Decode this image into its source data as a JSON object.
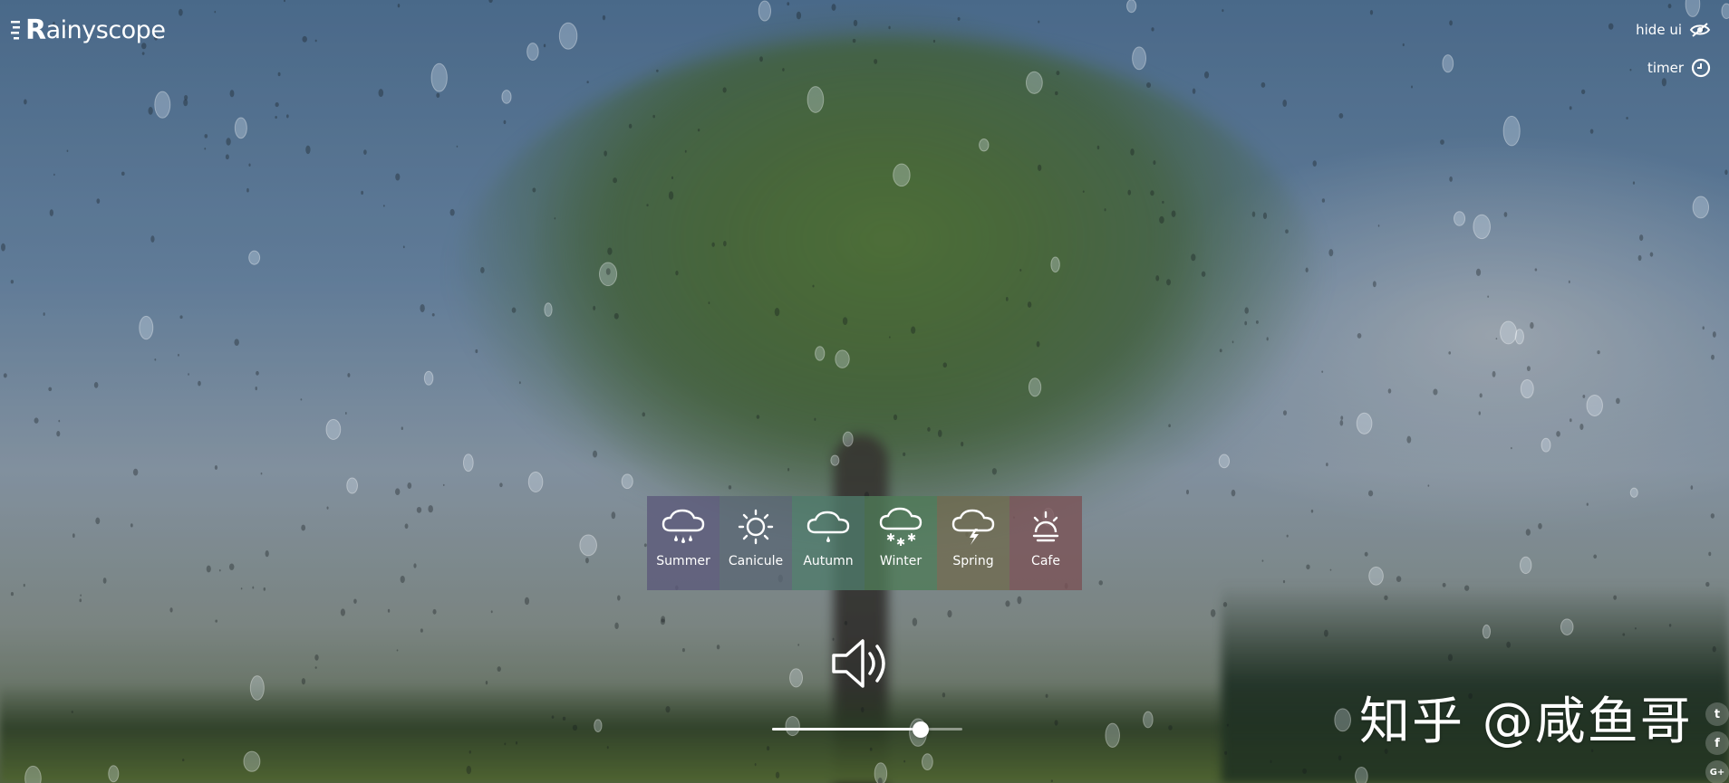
{
  "app": {
    "logo_text": "ainyscope",
    "logo_initial": "R"
  },
  "top_controls": {
    "hide_ui_label": "hide ui",
    "timer_label": "timer"
  },
  "seasons": [
    {
      "label": "Summer",
      "icon": "rain-cloud-icon",
      "color": "#5d5a7a"
    },
    {
      "label": "Canicule",
      "icon": "sun-icon",
      "color": "#5a6773"
    },
    {
      "label": "Autumn",
      "icon": "drizzle-cloud-icon",
      "color": "#4f7a6a"
    },
    {
      "label": "Winter",
      "icon": "snow-cloud-icon",
      "color": "#4f7b58"
    },
    {
      "label": "Spring",
      "icon": "storm-cloud-icon",
      "color": "#6f6a4f"
    },
    {
      "label": "Cafe",
      "icon": "sunrise-icon",
      "color": "#7a5256"
    }
  ],
  "volume": {
    "icon": "speaker-icon",
    "level": 0.78
  },
  "watermark": {
    "text": "知乎 @咸鱼哥"
  },
  "social": [
    {
      "icon": "twitter-icon",
      "glyph": "t"
    },
    {
      "icon": "facebook-icon",
      "glyph": "f"
    },
    {
      "icon": "google-plus-icon",
      "glyph": "G+"
    }
  ]
}
